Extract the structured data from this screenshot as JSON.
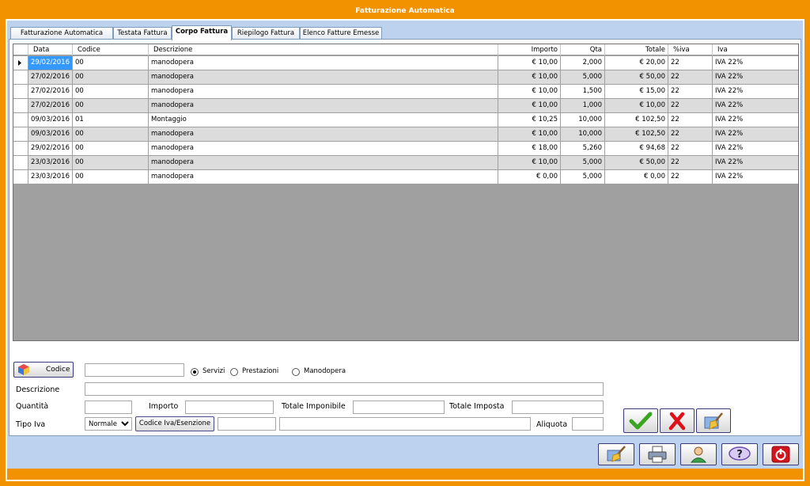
{
  "window": {
    "title": "Fatturazione Automatica"
  },
  "tabs": [
    {
      "label": "Fatturazione Automatica"
    },
    {
      "label": "Testata Fattura"
    },
    {
      "label": "Corpo Fattura"
    },
    {
      "label": "Riepilogo Fattura"
    },
    {
      "label": "Elenco Fatture Emesse"
    }
  ],
  "active_tab": "Corpo Fattura",
  "grid": {
    "columns": [
      "Data",
      "Codice",
      "Descrizione",
      "Importo",
      "Qta",
      "Totale",
      "%iva",
      "Iva"
    ],
    "rows": [
      [
        "29/02/2016",
        "00",
        "manodopera",
        "€ 10,00",
        "2,000",
        "€ 20,00",
        "22",
        "IVA 22%"
      ],
      [
        "27/02/2016",
        "00",
        "manodopera",
        "€ 10,00",
        "5,000",
        "€ 50,00",
        "22",
        "IVA 22%"
      ],
      [
        "27/02/2016",
        "00",
        "manodopera",
        "€ 10,00",
        "1,500",
        "€ 15,00",
        "22",
        "IVA 22%"
      ],
      [
        "27/02/2016",
        "00",
        "manodopera",
        "€ 10,00",
        "1,000",
        "€ 10,00",
        "22",
        "IVA 22%"
      ],
      [
        "09/03/2016",
        "01",
        "Montaggio",
        "€ 10,25",
        "10,000",
        "€ 102,50",
        "22",
        "IVA 22%"
      ],
      [
        "09/03/2016",
        "00",
        "manodopera",
        "€ 10,00",
        "10,000",
        "€ 102,50",
        "22",
        "IVA 22%"
      ],
      [
        "29/02/2016",
        "00",
        "manodopera",
        "€ 18,00",
        "5,260",
        "€ 94,68",
        "22",
        "IVA 22%"
      ],
      [
        "23/03/2016",
        "00",
        "manodopera",
        "€ 10,00",
        "5,000",
        "€ 50,00",
        "22",
        "IVA 22%"
      ],
      [
        "23/03/2016",
        "00",
        "manodopera",
        "€ 0,00",
        "5,000",
        "€ 0,00",
        "22",
        "IVA 22%"
      ]
    ]
  },
  "form": {
    "codice_button": "Codice",
    "codice_value": "",
    "radio_servizi": "Servizi",
    "radio_prestazioni": "Prestazioni",
    "radio_manodopera": "Manodopera",
    "radio_selected": "Servizi",
    "descrizione_label": "Descrizione",
    "descrizione_value": "",
    "quantita_label": "Quantità",
    "quantita_value": "",
    "importo_label": "Importo",
    "importo_value": "",
    "totale_imponibile_label": "Totale Imponibile",
    "totale_imponibile_value": "",
    "totale_imposta_label": "Totale Imposta",
    "totale_imposta_value": "",
    "tipo_iva_label": "Tipo Iva",
    "tipo_iva_selected": "Normale",
    "codice_iva_button": "Codice Iva/Esenzione",
    "codice_iva_value": "",
    "codice_iva_desc": "",
    "aliquota_label": "Aliquota",
    "aliquota_value": ""
  },
  "colors": {
    "title_bar": "#f39200",
    "client_bg": "#bcd2ee",
    "grid_empty": "#a0a0a0",
    "selection": "#3399ff"
  },
  "icons": {
    "codice_button": "cube-icon",
    "confirm": "check-icon",
    "cancel": "red-x-icon",
    "clear_form": "broom-icon",
    "clean": "broom-icon",
    "print": "printer-icon",
    "user": "user-icon",
    "help": "question-icon",
    "exit": "power-icon"
  }
}
